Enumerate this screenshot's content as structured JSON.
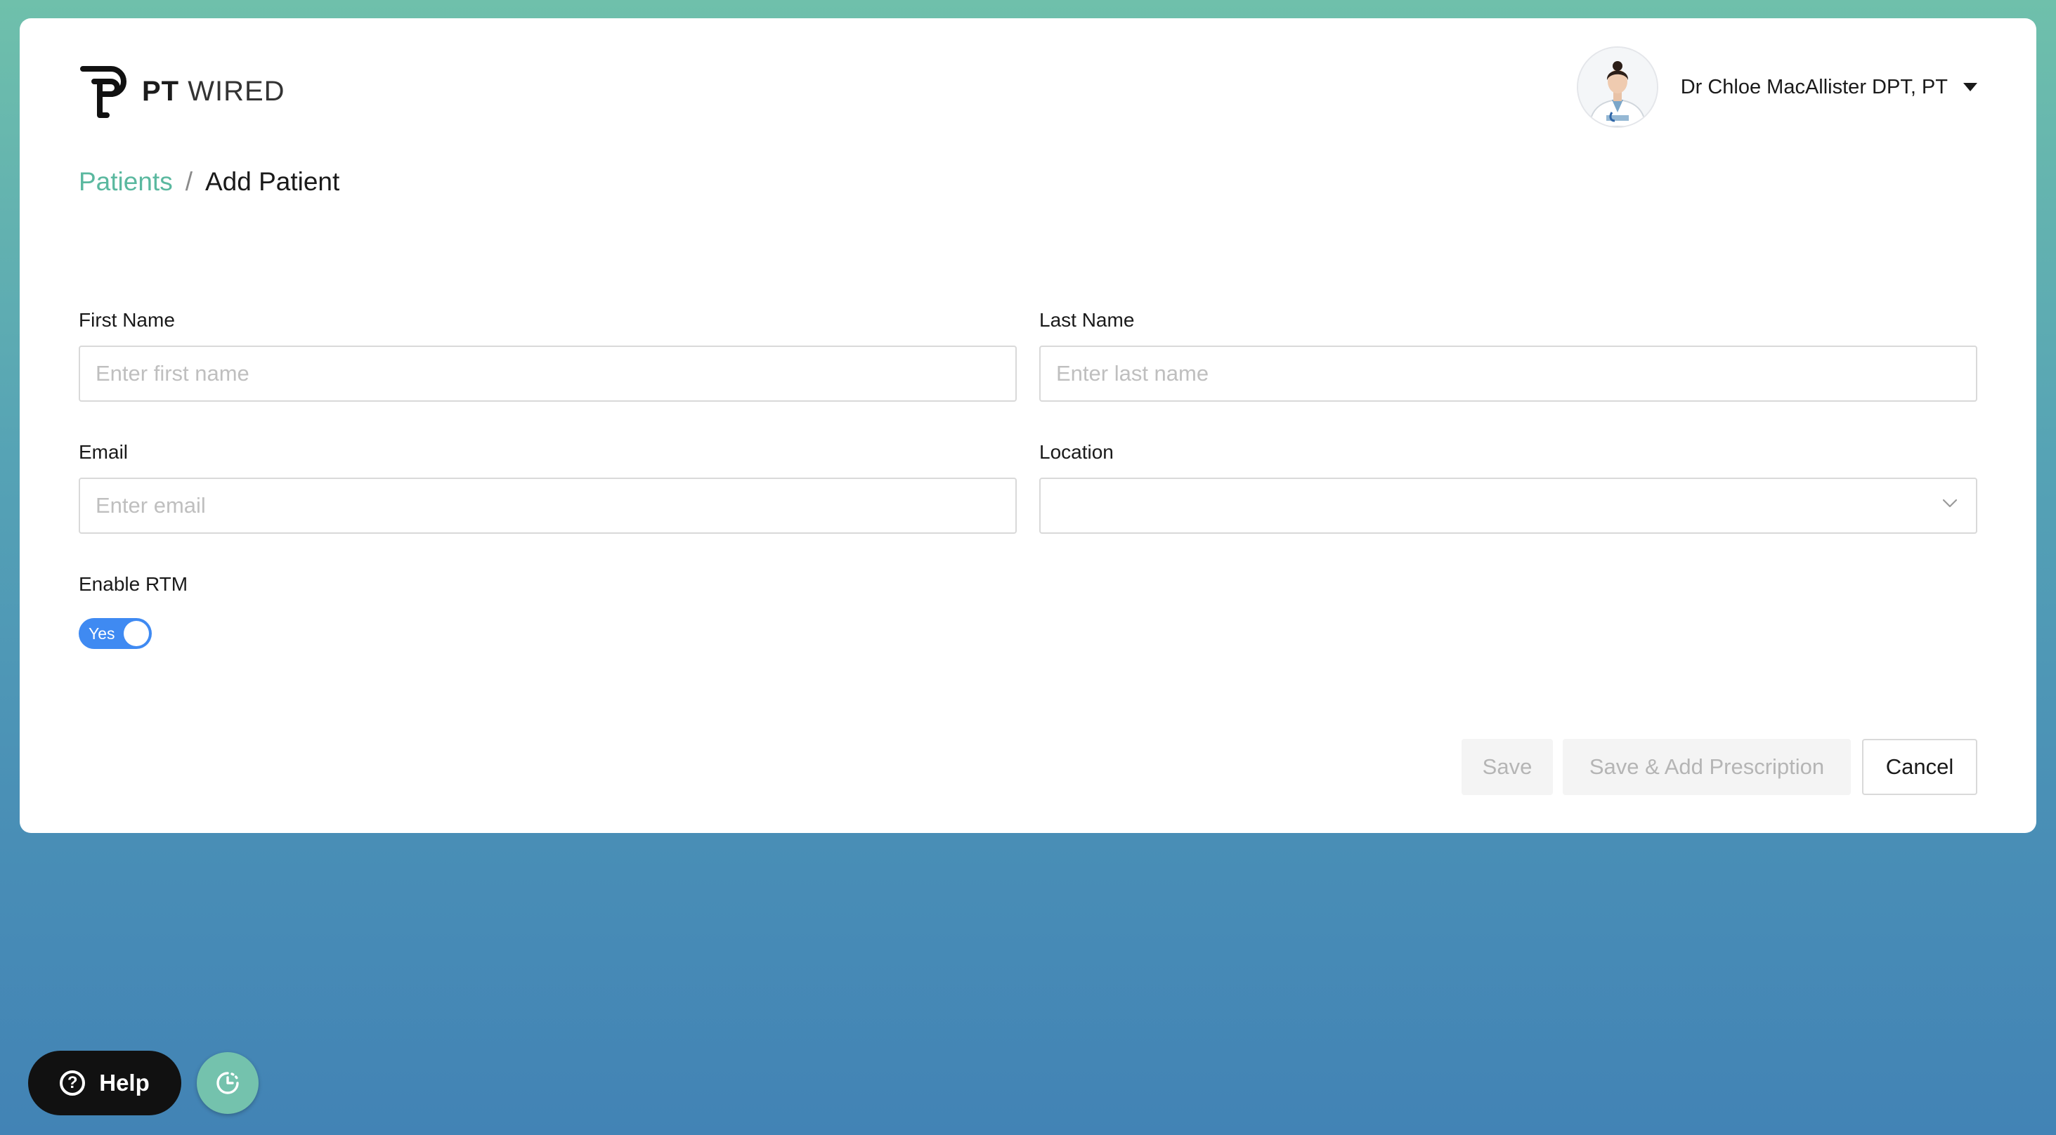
{
  "brand": {
    "name_bold": "PT",
    "name_light": "WIRED"
  },
  "user": {
    "name": "Dr Chloe MacAllister DPT, PT",
    "avatar_icon": "doctor-avatar-icon"
  },
  "breadcrumb": {
    "parent": "Patients",
    "separator": "/",
    "current": "Add Patient"
  },
  "form": {
    "first_name": {
      "label": "First Name",
      "value": "",
      "placeholder": "Enter first name"
    },
    "last_name": {
      "label": "Last Name",
      "value": "",
      "placeholder": "Enter last name"
    },
    "email": {
      "label": "Email",
      "value": "",
      "placeholder": "Enter email"
    },
    "location": {
      "label": "Location",
      "value": ""
    },
    "enable_rtm": {
      "label": "Enable RTM",
      "toggle_text": "Yes",
      "checked": true
    }
  },
  "actions": {
    "save_label": "Save",
    "save_add_label": "Save & Add Prescription",
    "cancel_label": "Cancel"
  },
  "floating": {
    "help_label": "Help",
    "help_icon": "question-circle-icon",
    "history_icon": "clock-icon"
  },
  "colors": {
    "accent": "#5ab89f",
    "toggle_on": "#3f8af2",
    "help_bg": "#111111"
  }
}
